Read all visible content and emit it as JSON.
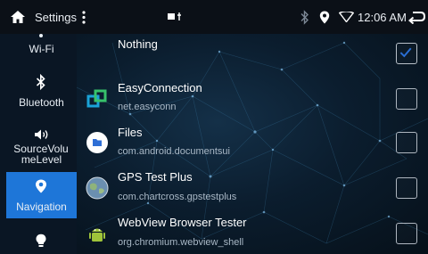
{
  "statusbar": {
    "title": "Settings",
    "time": "12:06 AM"
  },
  "sidebar": {
    "items": [
      {
        "label": "Wi-Fi",
        "icon": "wifi-icon"
      },
      {
        "label": "Bluetooth",
        "icon": "bluetooth-icon"
      },
      {
        "label": "SourceVolumeLevel",
        "line1": "SourceVolu",
        "line2": "meLevel",
        "icon": "volume-icon"
      },
      {
        "label": "Navigation",
        "icon": "location-pin-icon",
        "active": true
      },
      {
        "label": "",
        "icon": "lightbulb-icon"
      }
    ]
  },
  "apps": [
    {
      "name": "Nothing",
      "package": "",
      "checked": true
    },
    {
      "name": "EasyConnection",
      "package": "net.easyconn",
      "checked": false,
      "icon": "easyconnection-icon"
    },
    {
      "name": "Files",
      "package": "com.android.documentsui",
      "checked": false,
      "icon": "files-icon"
    },
    {
      "name": "GPS Test Plus",
      "package": "com.chartcross.gpstestplus",
      "checked": false,
      "icon": "gps-globe-icon"
    },
    {
      "name": "WebView Browser Tester",
      "package": "org.chromium.webview_shell",
      "checked": false,
      "icon": "android-icon"
    }
  ],
  "colors": {
    "accent": "#1e76d8",
    "checkbox_check": "#2a6fd6",
    "background": "#0b1d2e"
  }
}
